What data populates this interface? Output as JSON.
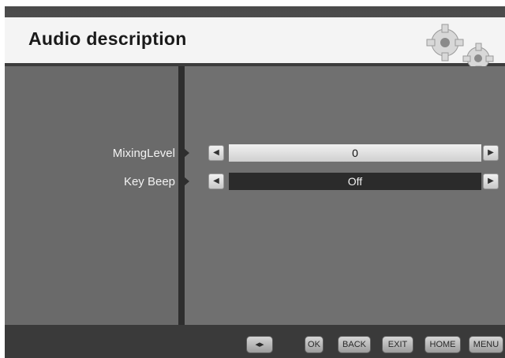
{
  "header": {
    "title": "Audio description"
  },
  "rows": [
    {
      "label": "MixingLevel",
      "value": "0"
    },
    {
      "label": "Key Beep",
      "value": "Off"
    }
  ],
  "footer": {
    "nav": "◂▸",
    "ok": "OK",
    "back": "BACK",
    "exit": "EXIT",
    "home": "HOME",
    "menu": "MENU"
  },
  "glyphs": {
    "left": "◀",
    "right": "▶"
  }
}
